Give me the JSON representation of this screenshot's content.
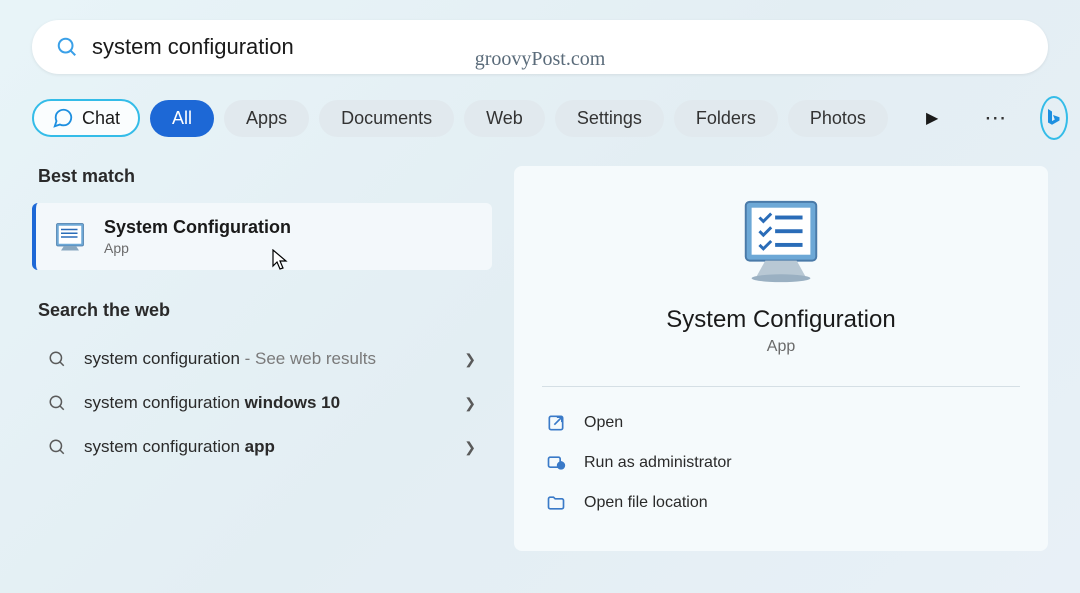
{
  "watermark": "groovyPost.com",
  "search": {
    "value": "system configuration"
  },
  "filters": {
    "chat": "Chat",
    "tabs": [
      "All",
      "Apps",
      "Documents",
      "Web",
      "Settings",
      "Folders",
      "Photos"
    ],
    "active_index": 0
  },
  "left": {
    "best_match_header": "Best match",
    "best_match": {
      "title": "System Configuration",
      "subtitle": "App"
    },
    "web_header": "Search the web",
    "web_items": [
      {
        "prefix": "system configuration",
        "bold": "",
        "hint": " - See web results"
      },
      {
        "prefix": "system configuration ",
        "bold": "windows 10",
        "hint": ""
      },
      {
        "prefix": "system configuration ",
        "bold": "app",
        "hint": ""
      }
    ]
  },
  "detail": {
    "title": "System Configuration",
    "subtitle": "App",
    "actions": [
      "Open",
      "Run as administrator",
      "Open file location"
    ]
  }
}
